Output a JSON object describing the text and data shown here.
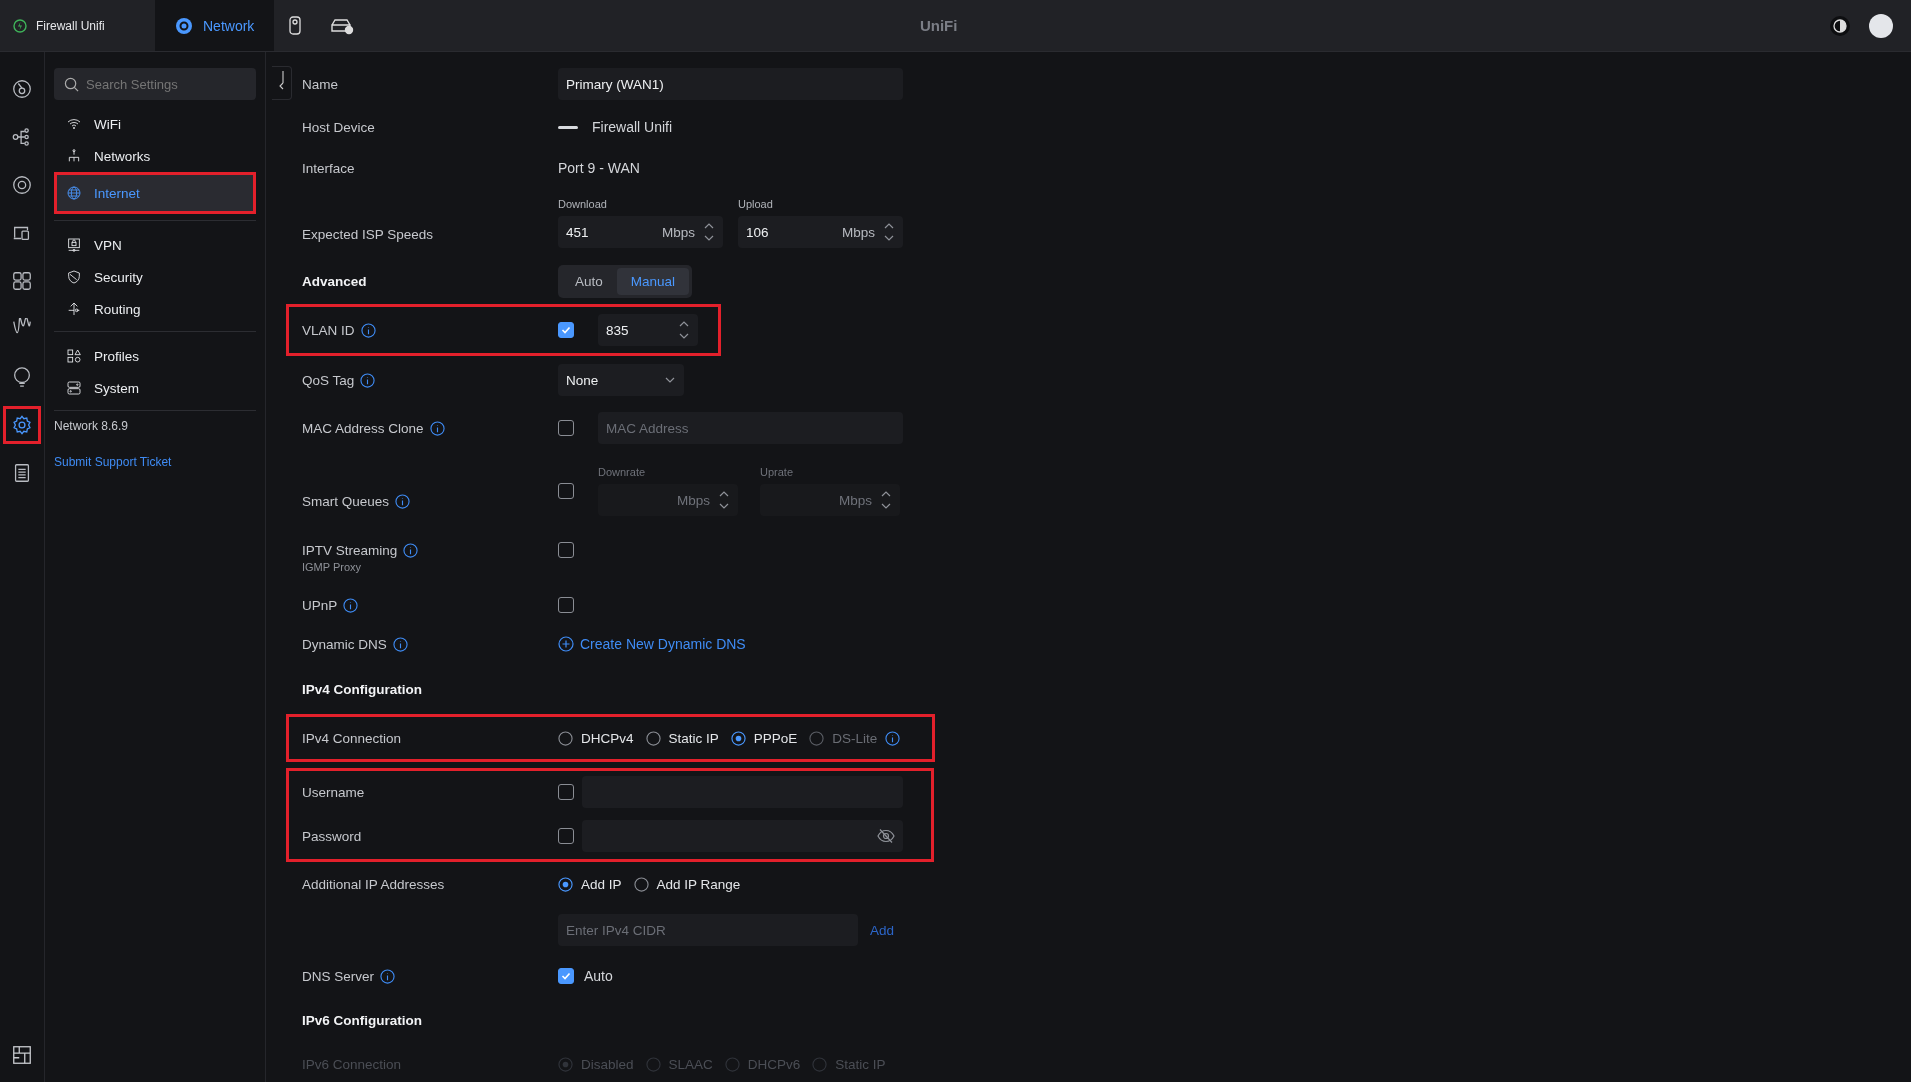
{
  "top_bar": {
    "console": "Firewall Unifi",
    "tabs": [
      {
        "kind": "network",
        "label": "Network",
        "selected": true
      },
      {
        "kind": "device",
        "selected": false
      },
      {
        "kind": "gateway",
        "selected": false
      }
    ],
    "brand": "UniFi"
  },
  "rail": [
    {
      "kind": "dashboard",
      "selected": false,
      "highlighted": false
    },
    {
      "kind": "topology",
      "selected": false,
      "highlighted": false
    },
    {
      "kind": "target",
      "selected": false,
      "highlighted": false
    },
    {
      "kind": "devices",
      "selected": false,
      "highlighted": false
    },
    {
      "kind": "clients",
      "selected": false,
      "highlighted": false
    },
    {
      "kind": "wave",
      "selected": false,
      "highlighted": false
    },
    {
      "kind": "bulb",
      "selected": false,
      "highlighted": false
    },
    {
      "kind": "gear",
      "selected": true,
      "highlighted": true
    },
    {
      "kind": "list",
      "selected": false,
      "highlighted": false
    }
  ],
  "rail_bottom": {
    "kind": "layout"
  },
  "sidebar": {
    "search": {
      "placeholder": "Search Settings"
    },
    "groups": [
      [
        {
          "kind": "wifi",
          "label": "WiFi",
          "selected": false,
          "highlighted": false
        },
        {
          "kind": "tree",
          "label": "Networks",
          "selected": false,
          "highlighted": false
        },
        {
          "kind": "globe",
          "label": "Internet",
          "selected": true,
          "highlighted": true
        }
      ],
      [
        {
          "kind": "vpn",
          "label": "VPN",
          "selected": false,
          "highlighted": false
        },
        {
          "kind": "shield",
          "label": "Security",
          "selected": false,
          "highlighted": false
        },
        {
          "kind": "routing",
          "label": "Routing",
          "selected": false,
          "highlighted": false
        }
      ],
      [
        {
          "kind": "shapes",
          "label": "Profiles",
          "selected": false,
          "highlighted": false
        },
        {
          "kind": "server",
          "label": "System",
          "selected": false,
          "highlighted": false
        }
      ]
    ],
    "version": "Network 8.6.9",
    "support_link": "Submit Support Ticket"
  },
  "form": [
    {
      "kind": "text-field",
      "label": "Name",
      "value": "Primary (WAN1)"
    },
    {
      "kind": "device",
      "label": "Host Device",
      "value": "Firewall Unifi"
    },
    {
      "kind": "text",
      "label": "Interface",
      "value": "Port 9 - WAN"
    },
    {
      "kind": "speeds",
      "label": "Expected ISP Speeds",
      "fields": [
        {
          "caption": "Download",
          "value": "451",
          "unit": "Mbps"
        },
        {
          "caption": "Upload",
          "value": "106",
          "unit": "Mbps"
        }
      ]
    },
    {
      "kind": "segmented",
      "label": "Advanced",
      "options": [
        {
          "label": "Auto",
          "selected": false
        },
        {
          "label": "Manual",
          "selected": true
        }
      ]
    },
    {
      "kind": "checkbox-number",
      "label": "VLAN ID",
      "info": true,
      "checked": true,
      "value": "835",
      "highlighted": true
    },
    {
      "kind": "select",
      "label": "QoS Tag",
      "info": true,
      "value": "None"
    },
    {
      "kind": "checkbox-field",
      "label": "MAC Address Clone",
      "info": true,
      "checked": false,
      "placeholder": "MAC Address"
    },
    {
      "kind": "checkbox-rates",
      "label": "Smart Queues",
      "info": true,
      "checked": false,
      "fields": [
        {
          "caption": "Downrate",
          "unit": "Mbps"
        },
        {
          "caption": "Uprate",
          "unit": "Mbps"
        }
      ]
    },
    {
      "kind": "checkbox",
      "label": "IPTV Streaming",
      "info": true,
      "sublabel": "IGMP Proxy",
      "checked": false
    },
    {
      "kind": "checkbox",
      "label": "UPnP",
      "info": true,
      "checked": false
    },
    {
      "kind": "link",
      "label": "Dynamic DNS",
      "info": true,
      "link": "Create New Dynamic DNS"
    },
    {
      "kind": "heading",
      "label": "IPv4 Configuration"
    },
    {
      "kind": "radios",
      "label": "IPv4 Connection",
      "disabled": false,
      "highlighted": true,
      "options": [
        {
          "label": "DHCPv4",
          "selected": false,
          "disabled": false
        },
        {
          "label": "Static IP",
          "selected": false,
          "disabled": false
        },
        {
          "label": "PPPoE",
          "selected": true,
          "disabled": false
        },
        {
          "label": "DS-Lite",
          "selected": false,
          "disabled": true,
          "info": true
        }
      ]
    },
    {
      "kind": "group",
      "highlighted": true,
      "rows": [
        {
          "kind": "checkbox-input",
          "label": "Username",
          "checked": false
        },
        {
          "kind": "checkbox-password",
          "label": "Password",
          "checked": false
        }
      ]
    },
    {
      "kind": "radios",
      "label": "Additional IP Addresses",
      "disabled": false,
      "options": [
        {
          "label": "Add IP",
          "selected": true,
          "disabled": false
        },
        {
          "label": "Add IP Range",
          "selected": false,
          "disabled": false
        }
      ]
    },
    {
      "kind": "cidr",
      "placeholder": "Enter IPv4 CIDR",
      "action": "Add"
    },
    {
      "kind": "checkbox-label",
      "label": "DNS Server",
      "info": true,
      "checked": true,
      "text": "Auto"
    },
    {
      "kind": "heading",
      "label": "IPv6 Configuration"
    },
    {
      "kind": "radios",
      "label": "IPv6 Connection",
      "disabled": true,
      "options": [
        {
          "label": "Disabled",
          "selected": true
        },
        {
          "label": "SLAAC",
          "selected": false
        },
        {
          "label": "DHCPv6",
          "selected": false
        },
        {
          "label": "Static IP",
          "selected": false
        }
      ]
    }
  ]
}
